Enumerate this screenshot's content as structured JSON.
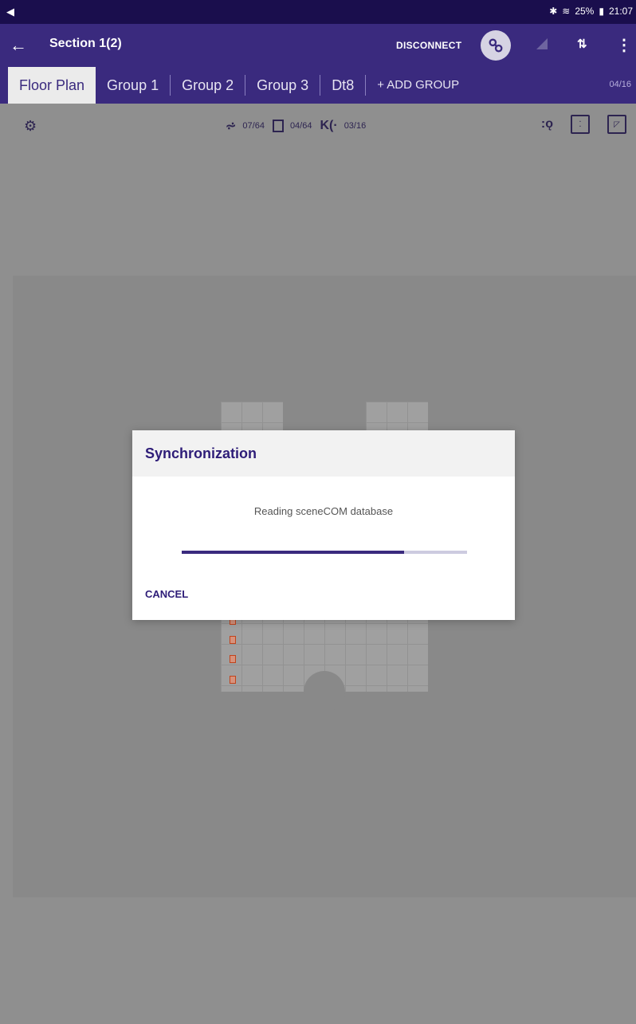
{
  "status_bar": {
    "left_icon": "navigation-arrow",
    "bluetooth_icon": "bluetooth",
    "wifi_icon": "wifi",
    "battery": "25%",
    "time": "21:07"
  },
  "app_bar": {
    "title": "Section 1(2)",
    "disconnect_label": "DISCONNECT"
  },
  "tabs": {
    "items": [
      "Floor Plan",
      "Group 1",
      "Group 2",
      "Group 3",
      "Dt8",
      "+ ADD GROUP"
    ],
    "counter": "04/16"
  },
  "toolbar": {
    "lights_count": "07/64",
    "devices_count": "04/64",
    "sensors_count": "03/16"
  },
  "dialog": {
    "title": "Synchronization",
    "message": "Reading sceneCOM database",
    "progress": 0.78,
    "cancel_label": "CANCEL"
  },
  "colors": {
    "primary": "#3a2a7e",
    "status_bar": "#1a0e4d",
    "overlay": "#8f8f8f"
  }
}
